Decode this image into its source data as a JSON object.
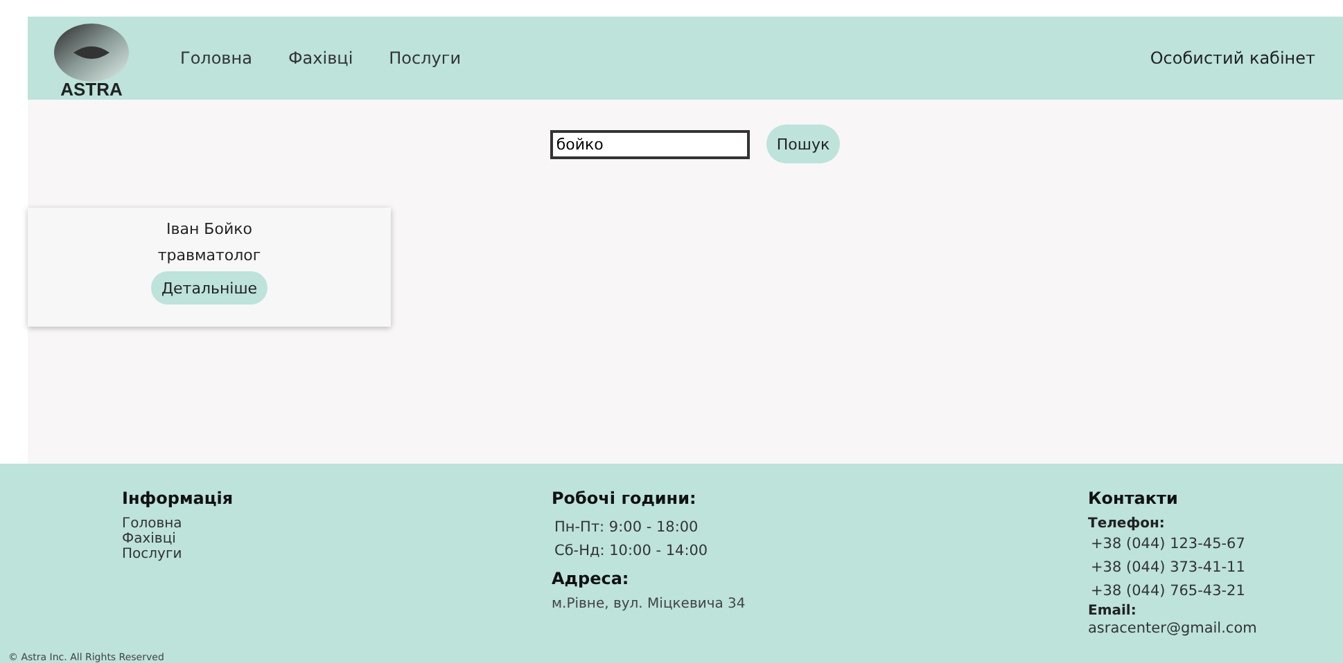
{
  "header": {
    "logo_text": "ASTRA",
    "nav": [
      "Головна",
      "Фахівці",
      "Послуги"
    ],
    "account_link": "Особистий кабінет"
  },
  "search": {
    "value": "бойко",
    "button": "Пошук"
  },
  "doctors": [
    {
      "name": "Іван Бойко",
      "specialty": "травматолог",
      "button": "Детальніше"
    }
  ],
  "footer": {
    "info": {
      "title": "Інформація",
      "links": [
        "Головна",
        "Фахівці",
        "Послуги"
      ]
    },
    "hours": {
      "title": "Робочі години:",
      "lines": [
        "Пн-Пт: 9:00 - 18:00",
        "Сб-Нд: 10:00 - 14:00"
      ],
      "address_title": "Адреса:",
      "address": "м.Рівне, вул. Міцкевича 34"
    },
    "contacts": {
      "title": "Контакти",
      "phone_label": "Телефон:",
      "phones": [
        "+38 (044) 123-45-67",
        "+38 (044) 373-41-11",
        "+38 (044) 765-43-21"
      ],
      "email_label": "Email:",
      "email": "asracenter@gmail.com"
    },
    "copyright": "© Astra Inc. All Rights Reserved"
  }
}
